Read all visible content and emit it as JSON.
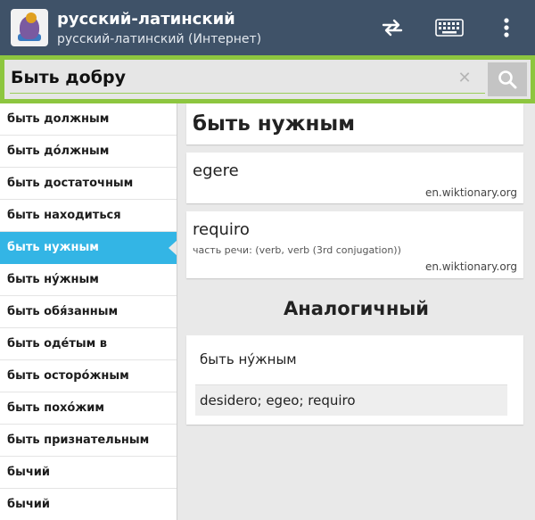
{
  "app": {
    "title": "русский-латинский",
    "subtitle": "русский-латинский (Интернет)",
    "icon": "dictionary-parrot-icon",
    "colors": {
      "toolbar": "#3f5268",
      "search_frame": "#8dc63f",
      "selected_item": "#33b5e5"
    }
  },
  "actions": [
    {
      "name": "swap-languages-icon"
    },
    {
      "name": "keyboard-icon"
    },
    {
      "name": "overflow-menu-icon"
    }
  ],
  "search": {
    "value": "Быть добру",
    "clear_symbol": "✕",
    "button_icon": "search-icon"
  },
  "sidebar": {
    "items": [
      {
        "label": "быть должным"
      },
      {
        "label": "быть до́лжным"
      },
      {
        "label": "быть достаточным"
      },
      {
        "label": "быть находиться"
      },
      {
        "label": "быть нужным",
        "selected": true
      },
      {
        "label": "быть ну́жным"
      },
      {
        "label": "быть обя́занным"
      },
      {
        "label": "быть оде́тым в"
      },
      {
        "label": "быть осторо́жным"
      },
      {
        "label": "быть похо́жим"
      },
      {
        "label": "быть признательным"
      },
      {
        "label": "бычий"
      },
      {
        "label": "бычий"
      }
    ]
  },
  "entry": {
    "headword": "быть нужным",
    "translations": [
      {
        "word": "egere",
        "source": "en.wiktionary.org"
      },
      {
        "word": "requiro",
        "pos": "часть речи: (verb, verb (3rd conjugation))",
        "source": "en.wiktionary.org"
      }
    ]
  },
  "similar": {
    "heading": "Аналогичный",
    "items": [
      {
        "word": "быть ну́жным",
        "translation": "desidero; egeo; requiro"
      }
    ]
  }
}
